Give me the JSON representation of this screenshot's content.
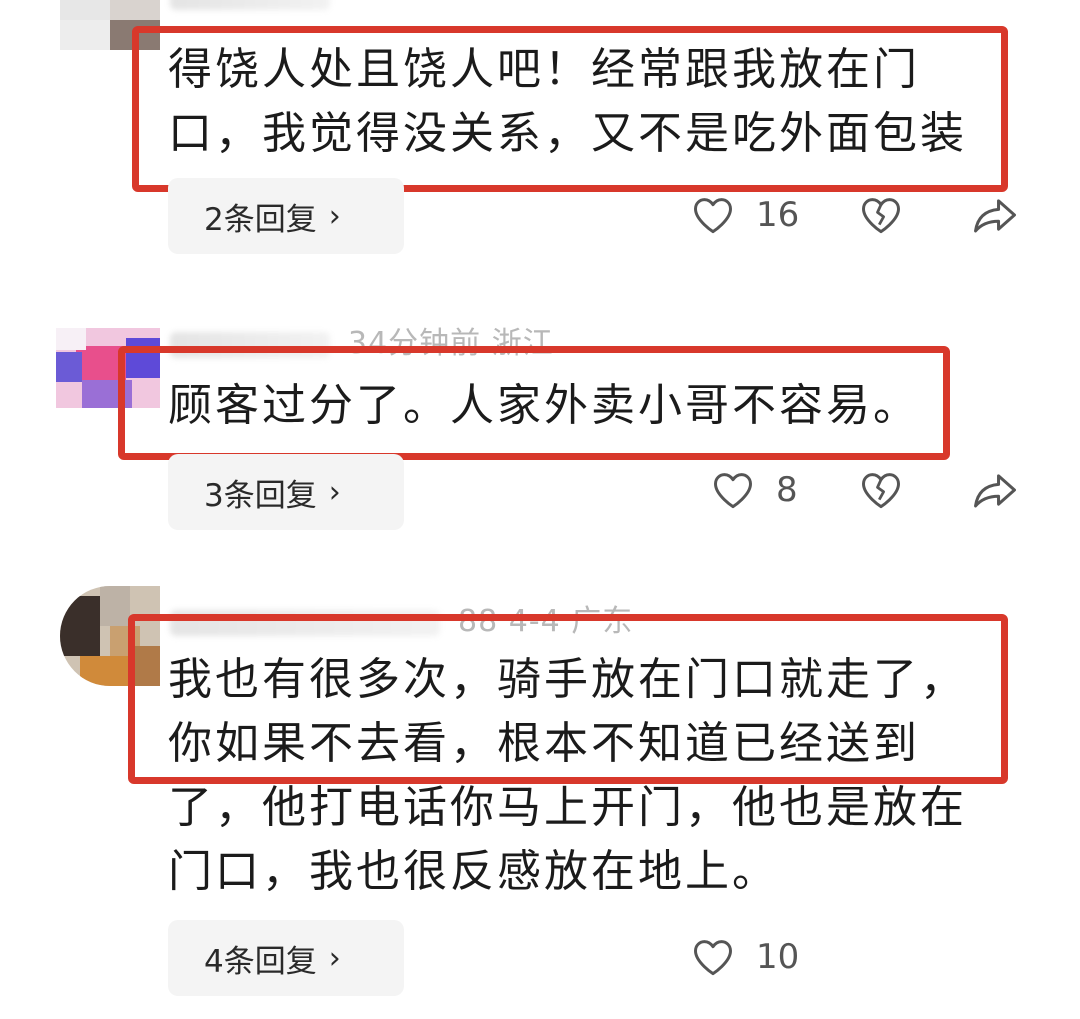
{
  "comments": [
    {
      "meta": "",
      "lines": [
        "得饶人处且饶人吧！经常跟我放在门",
        "口，我觉得没关系，又不是吃外面包装"
      ],
      "replies": "2条回复",
      "likes": "16"
    },
    {
      "meta": "34分钟前 浙江",
      "lines": [
        "顾客过分了。人家外卖小哥不容易。"
      ],
      "replies": "3条回复",
      "likes": "8"
    },
    {
      "meta": "88 4-4 广东",
      "lines": [
        "我也有很多次，骑手放在门口就走了，",
        "你如果不去看，根本不知道已经送到",
        "了，他打电话你马上开门，他也是放在",
        "门口，我也很反感放在地上。"
      ],
      "replies": "4条回复",
      "likes": "10"
    }
  ],
  "icons": {
    "like": "heart-outline-icon",
    "dislike": "broken-heart-icon",
    "share": "share-arrow-icon",
    "reply_arrow": "chevron-right-icon"
  },
  "colors": {
    "highlight_box": "#d8382b",
    "pill_bg": "#f4f4f4",
    "meta_text": "#b8b8b8"
  }
}
